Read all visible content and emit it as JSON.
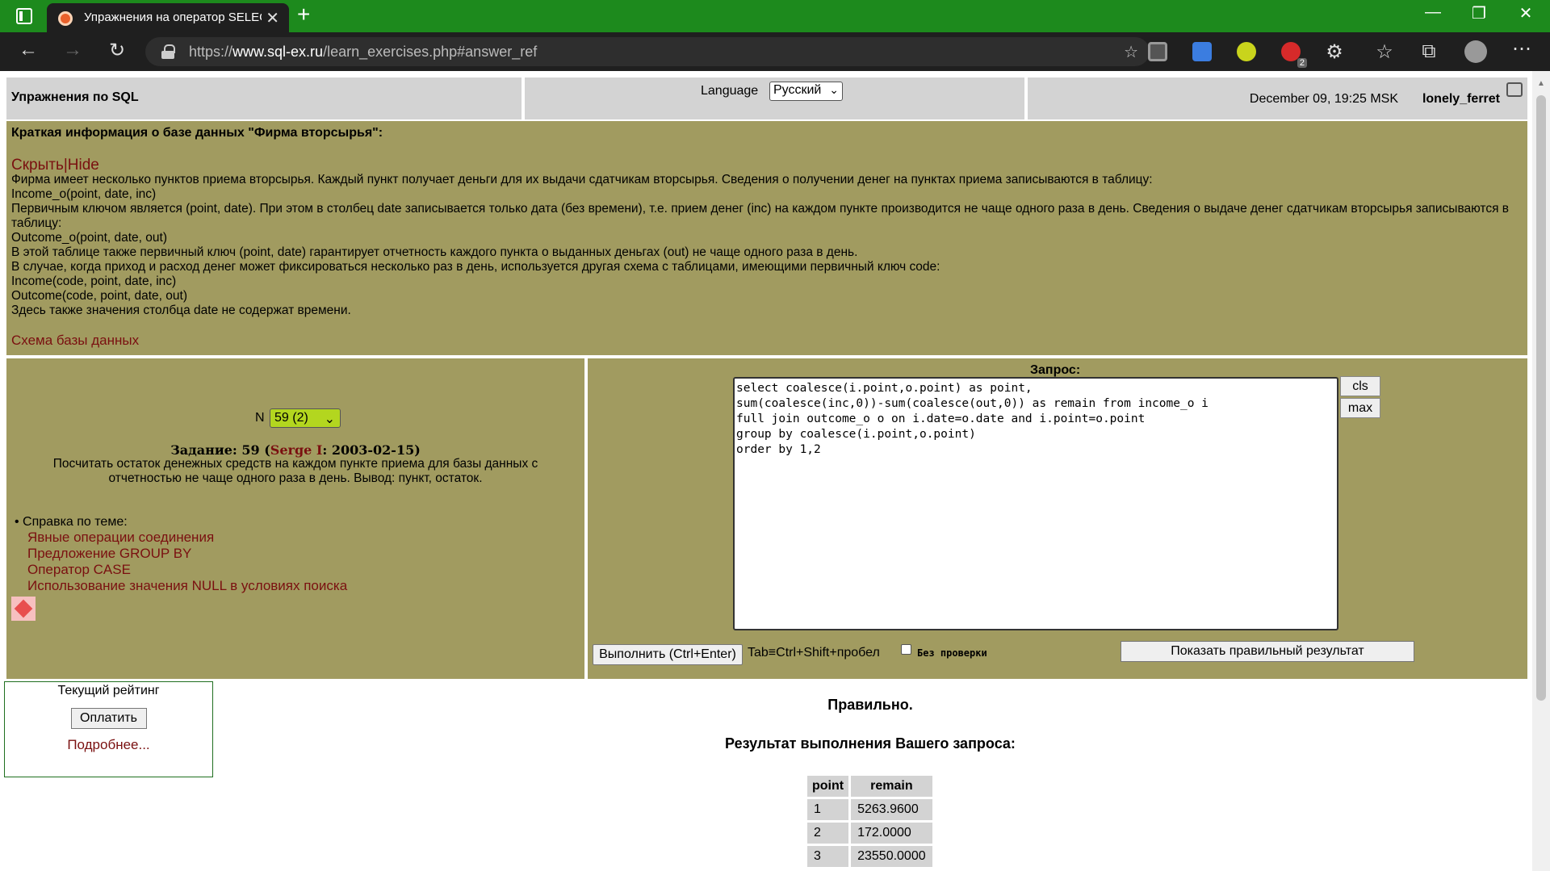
{
  "browser": {
    "tab_title": "Упражнения на оператор SELEC",
    "url_prefix": "https://",
    "url_domain": "www.sql-ex.ru",
    "url_path": "/learn_exercises.php#answer_ref",
    "extension_badge": "2"
  },
  "header": {
    "site_title": "Упражнения по SQL",
    "language_label": "Language",
    "language_value": "Русский",
    "datetime": "December 09, 19:25 MSK",
    "username": "lonely_ferret"
  },
  "info": {
    "title": "Краткая информация о базе данных \"Фирма вторсырья\":",
    "hide_link": "Скрыть|Hide",
    "lines": [
      "Фирма имеет несколько пунктов приема вторсырья. Каждый пункт получает деньги для их выдачи сдатчикам вторсырья. Сведения о получении денег на пунктах приема записываются в таблицу:",
      "Income_o(point, date, inc)",
      "Первичным ключом является (point, date). При этом в столбец date записывается только дата (без времени), т.е. прием денег (inc) на каждом пункте производится не чаще одного раза в день. Сведения о выдаче денег сдатчикам вторсырья записываются в таблицу:",
      "Outcome_o(point, date, out)",
      "В этой таблице также первичный ключ (point, date) гарантирует отчетность каждого пункта о выданных деньгах (out) не чаще одного раза в день.",
      "В случае, когда приход и расход денег может фиксироваться несколько раз в день, используется другая схема с таблицами, имеющими первичный ключ code:",
      "Income(code, point, date, inc)",
      "Outcome(code, point, date, out)",
      "Здесь также значения столбца date не содержат времени."
    ],
    "schema_link": "Схема базы данных"
  },
  "task": {
    "n_label": "N",
    "n_value": "59 (2)",
    "head_prefix": "Задание: 59 (",
    "author": "Serge I",
    "head_suffix": ": 2003-02-15)",
    "text": "Посчитать остаток денежных средств на каждом пункте приема для базы данных с отчетностью не чаще одного раза в день. Вывод: пункт, остаток.",
    "help_title": "• Справка по теме:",
    "help_links": [
      "Явные операции соединения",
      "Предложение GROUP BY",
      "Оператор CASE",
      "Использование значения NULL в условиях поиска"
    ]
  },
  "query": {
    "label": "Запрос:",
    "sql": "select coalesce(i.point,o.point) as point,\nsum(coalesce(inc,0))-sum(coalesce(out,0)) as remain from income_o i\nfull join outcome_o o on i.date=o.date and i.point=o.point\ngroup by coalesce(i.point,o.point)\norder by 1,2",
    "cls_label": "cls",
    "max_label": "max",
    "run_label": "Выполнить (Ctrl+Enter)",
    "tab_hint": "Tab≡Ctrl+Shift+пробел",
    "no_check_label": "Без проверки",
    "show_result_label": "Показать правильный результат"
  },
  "rating": {
    "title": "Текущий рейтинг",
    "pay_label": "Оплатить",
    "more_link": "Подробнее..."
  },
  "result": {
    "status": "Правильно.",
    "title": "Результат выполнения Вашего запроса:",
    "columns": [
      "point",
      "remain"
    ],
    "rows": [
      [
        "1",
        "5263.9600"
      ],
      [
        "2",
        "172.0000"
      ],
      [
        "3",
        "23550.0000"
      ]
    ]
  }
}
